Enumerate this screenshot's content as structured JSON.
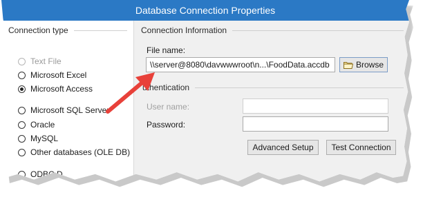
{
  "window": {
    "title": "Database Connection Properties"
  },
  "connection_type": {
    "header": "Connection type",
    "options": [
      {
        "label": "Text File",
        "state": "disabled"
      },
      {
        "label": "Microsoft Excel",
        "state": "unchecked"
      },
      {
        "label": "Microsoft Access",
        "state": "checked"
      },
      {
        "label": "Microsoft SQL Server",
        "state": "unchecked"
      },
      {
        "label": "Oracle",
        "state": "unchecked"
      },
      {
        "label": "MySQL",
        "state": "unchecked"
      },
      {
        "label": "Other databases (OLE DB)",
        "state": "unchecked"
      },
      {
        "label": "ODBC D",
        "state": "unchecked"
      }
    ]
  },
  "connection_info": {
    "header": "Connection Information",
    "file_name_label": "File name:",
    "file_name_value": "\\\\server@8080\\davwwwroot\\n...\\FoodData.accdb",
    "browse_label": "Browse",
    "authentication_header": "uthentication",
    "user_name_label": "User name:",
    "user_name_value": "",
    "password_label": "Password:",
    "password_value": "",
    "advanced_setup_label": "Advanced Setup",
    "test_connection_label": "Test Connection"
  },
  "colors": {
    "titlebar": "#2b79c5",
    "arrow": "#e8413a"
  },
  "icons": {
    "browse": "folder-icon",
    "annotation": "arrow-icon"
  }
}
